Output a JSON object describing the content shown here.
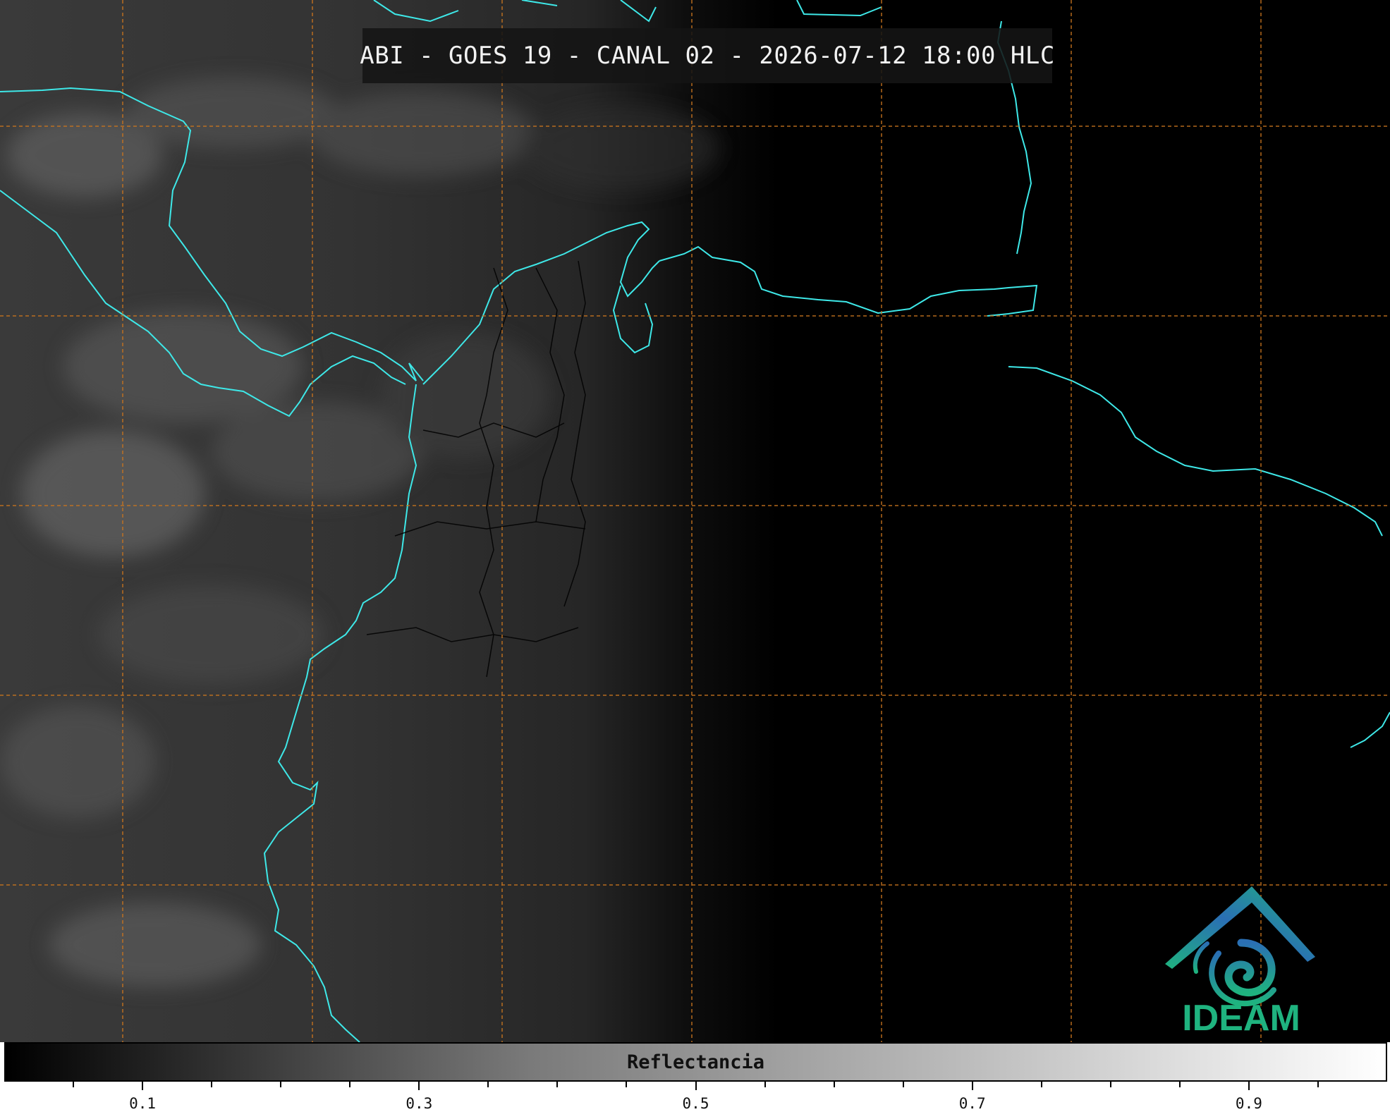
{
  "title": "ABI - GOES 19 - CANAL 02 - 2026-07-12 18:00 HLC",
  "colorbar": {
    "label": "Reflectancia",
    "range": [
      0.0,
      1.0
    ],
    "tick_labels": [
      "0.1",
      "0.3",
      "0.5",
      "0.7",
      "0.9"
    ],
    "tick_values": [
      0.1,
      0.3,
      0.5,
      0.7,
      0.9
    ]
  },
  "logo": {
    "text": "IDEAM"
  },
  "colors": {
    "coastline": "#3ee8e8",
    "gridline": "#c8741e",
    "background": "#000000",
    "logo_green": "#1fb37f",
    "logo_blue": "#2a6fb4"
  }
}
